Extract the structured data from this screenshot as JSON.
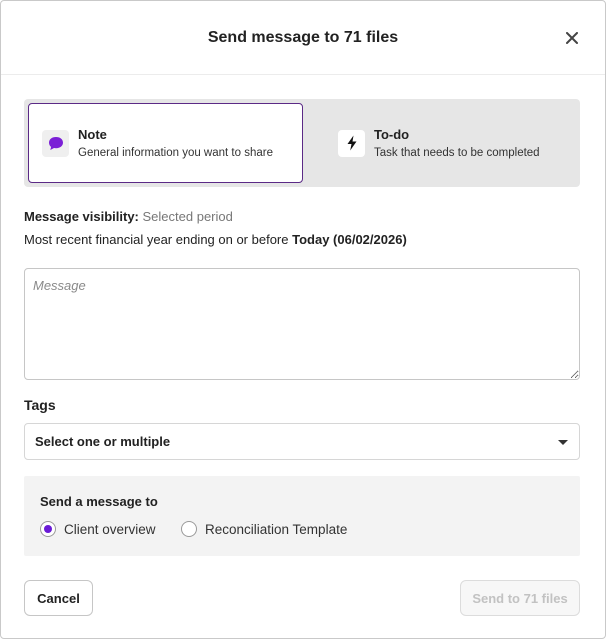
{
  "dialog": {
    "title": "Send message to 71 files"
  },
  "message_type": {
    "selected": "note",
    "options": [
      {
        "id": "note",
        "title": "Note",
        "description": "General information you want to share",
        "icon": "speech-bubble-icon",
        "icon_color": "#7b1fd6"
      },
      {
        "id": "todo",
        "title": "To-do",
        "description": "Task that needs to be completed",
        "icon": "lightning-bolt-icon",
        "icon_color": "#111111"
      }
    ]
  },
  "visibility": {
    "label": "Message visibility:",
    "value": "Selected period",
    "description_prefix": "Most recent financial year ending on or before",
    "description_date": "Today (06/02/2026)"
  },
  "message": {
    "value": "",
    "placeholder": "Message"
  },
  "tags": {
    "label": "Tags",
    "selected_text": "Select one or multiple"
  },
  "send_to": {
    "title": "Send a message to",
    "selected": "client-overview",
    "options": [
      {
        "id": "client-overview",
        "label": "Client overview",
        "checked": true
      },
      {
        "id": "reconciliation-template",
        "label": "Reconciliation Template",
        "checked": false
      }
    ]
  },
  "footer": {
    "cancel_label": "Cancel",
    "submit_label": "Send to 71 files",
    "submit_disabled": true
  },
  "colors": {
    "accent": "#6a1bd6",
    "selected_border": "#5b2a86"
  }
}
